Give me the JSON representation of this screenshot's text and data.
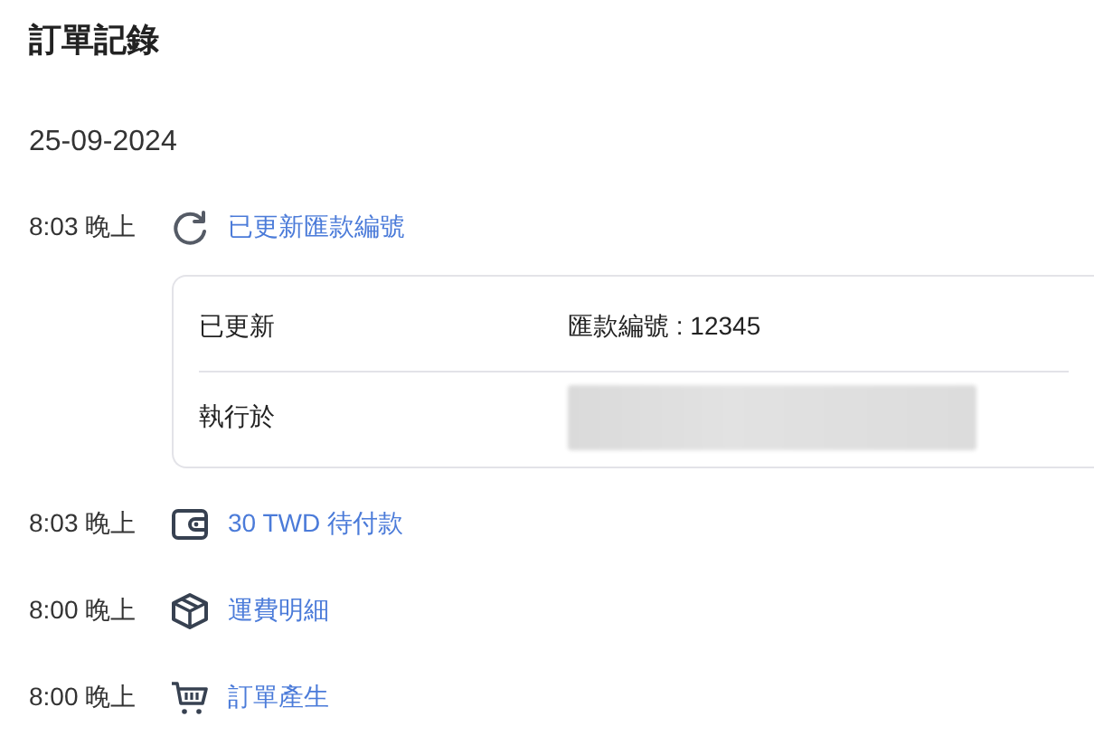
{
  "title": "訂單記錄",
  "date": "25-09-2024",
  "entries": [
    {
      "time": "8:03 晚上",
      "kind": "refresh",
      "label": "已更新匯款編號",
      "details": [
        {
          "label": "已更新",
          "value": "匯款編號 : 12345",
          "redacted": false
        },
        {
          "label": "執行於",
          "redacted": true
        }
      ]
    },
    {
      "time": "8:03 晚上",
      "kind": "wallet",
      "label": "30 TWD 待付款"
    },
    {
      "time": "8:00 晚上",
      "kind": "box",
      "label": "運費明細"
    },
    {
      "time": "8:00 晚上",
      "kind": "cart",
      "label": "訂單產生"
    }
  ]
}
